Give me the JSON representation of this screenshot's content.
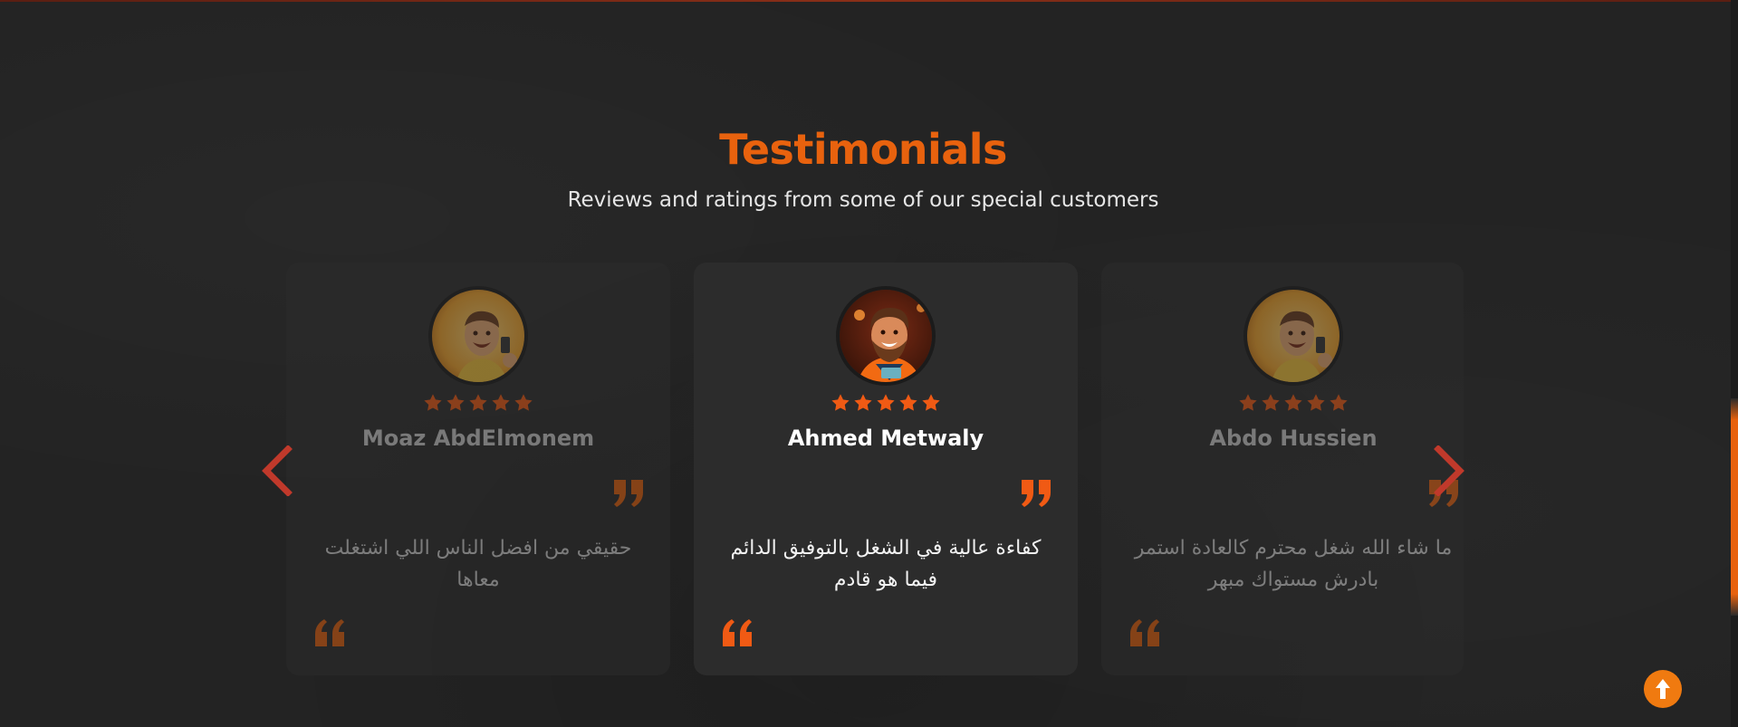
{
  "section": {
    "title": "Testimonials",
    "subtitle": "Reviews and ratings from some of our special customers"
  },
  "testimonials": [
    {
      "name": "Moaz AbdElmonem",
      "rating": 5,
      "review": "حقيقي من افضل الناس اللي اشتغلت معاها",
      "state": "inactive"
    },
    {
      "name": "Ahmed Metwaly",
      "rating": 5,
      "review": "كفاءة عالية في الشغل بالتوفيق الدائم فيما هو قادم",
      "state": "active"
    },
    {
      "name": "Abdo Hussien",
      "rating": 5,
      "review": "ما شاء الله شغل محترم كالعادة استمر بادرش مستواك مبهر",
      "state": "inactive"
    }
  ],
  "controls": {
    "prev_icon": "chevron-left-icon",
    "next_icon": "chevron-right-icon",
    "back_to_top_icon": "arrow-up-icon"
  },
  "colors": {
    "accent": "#e8620e",
    "arrow": "#c0392b",
    "background": "#232323",
    "card": "#2c2c2c",
    "star": "#f05a14"
  }
}
